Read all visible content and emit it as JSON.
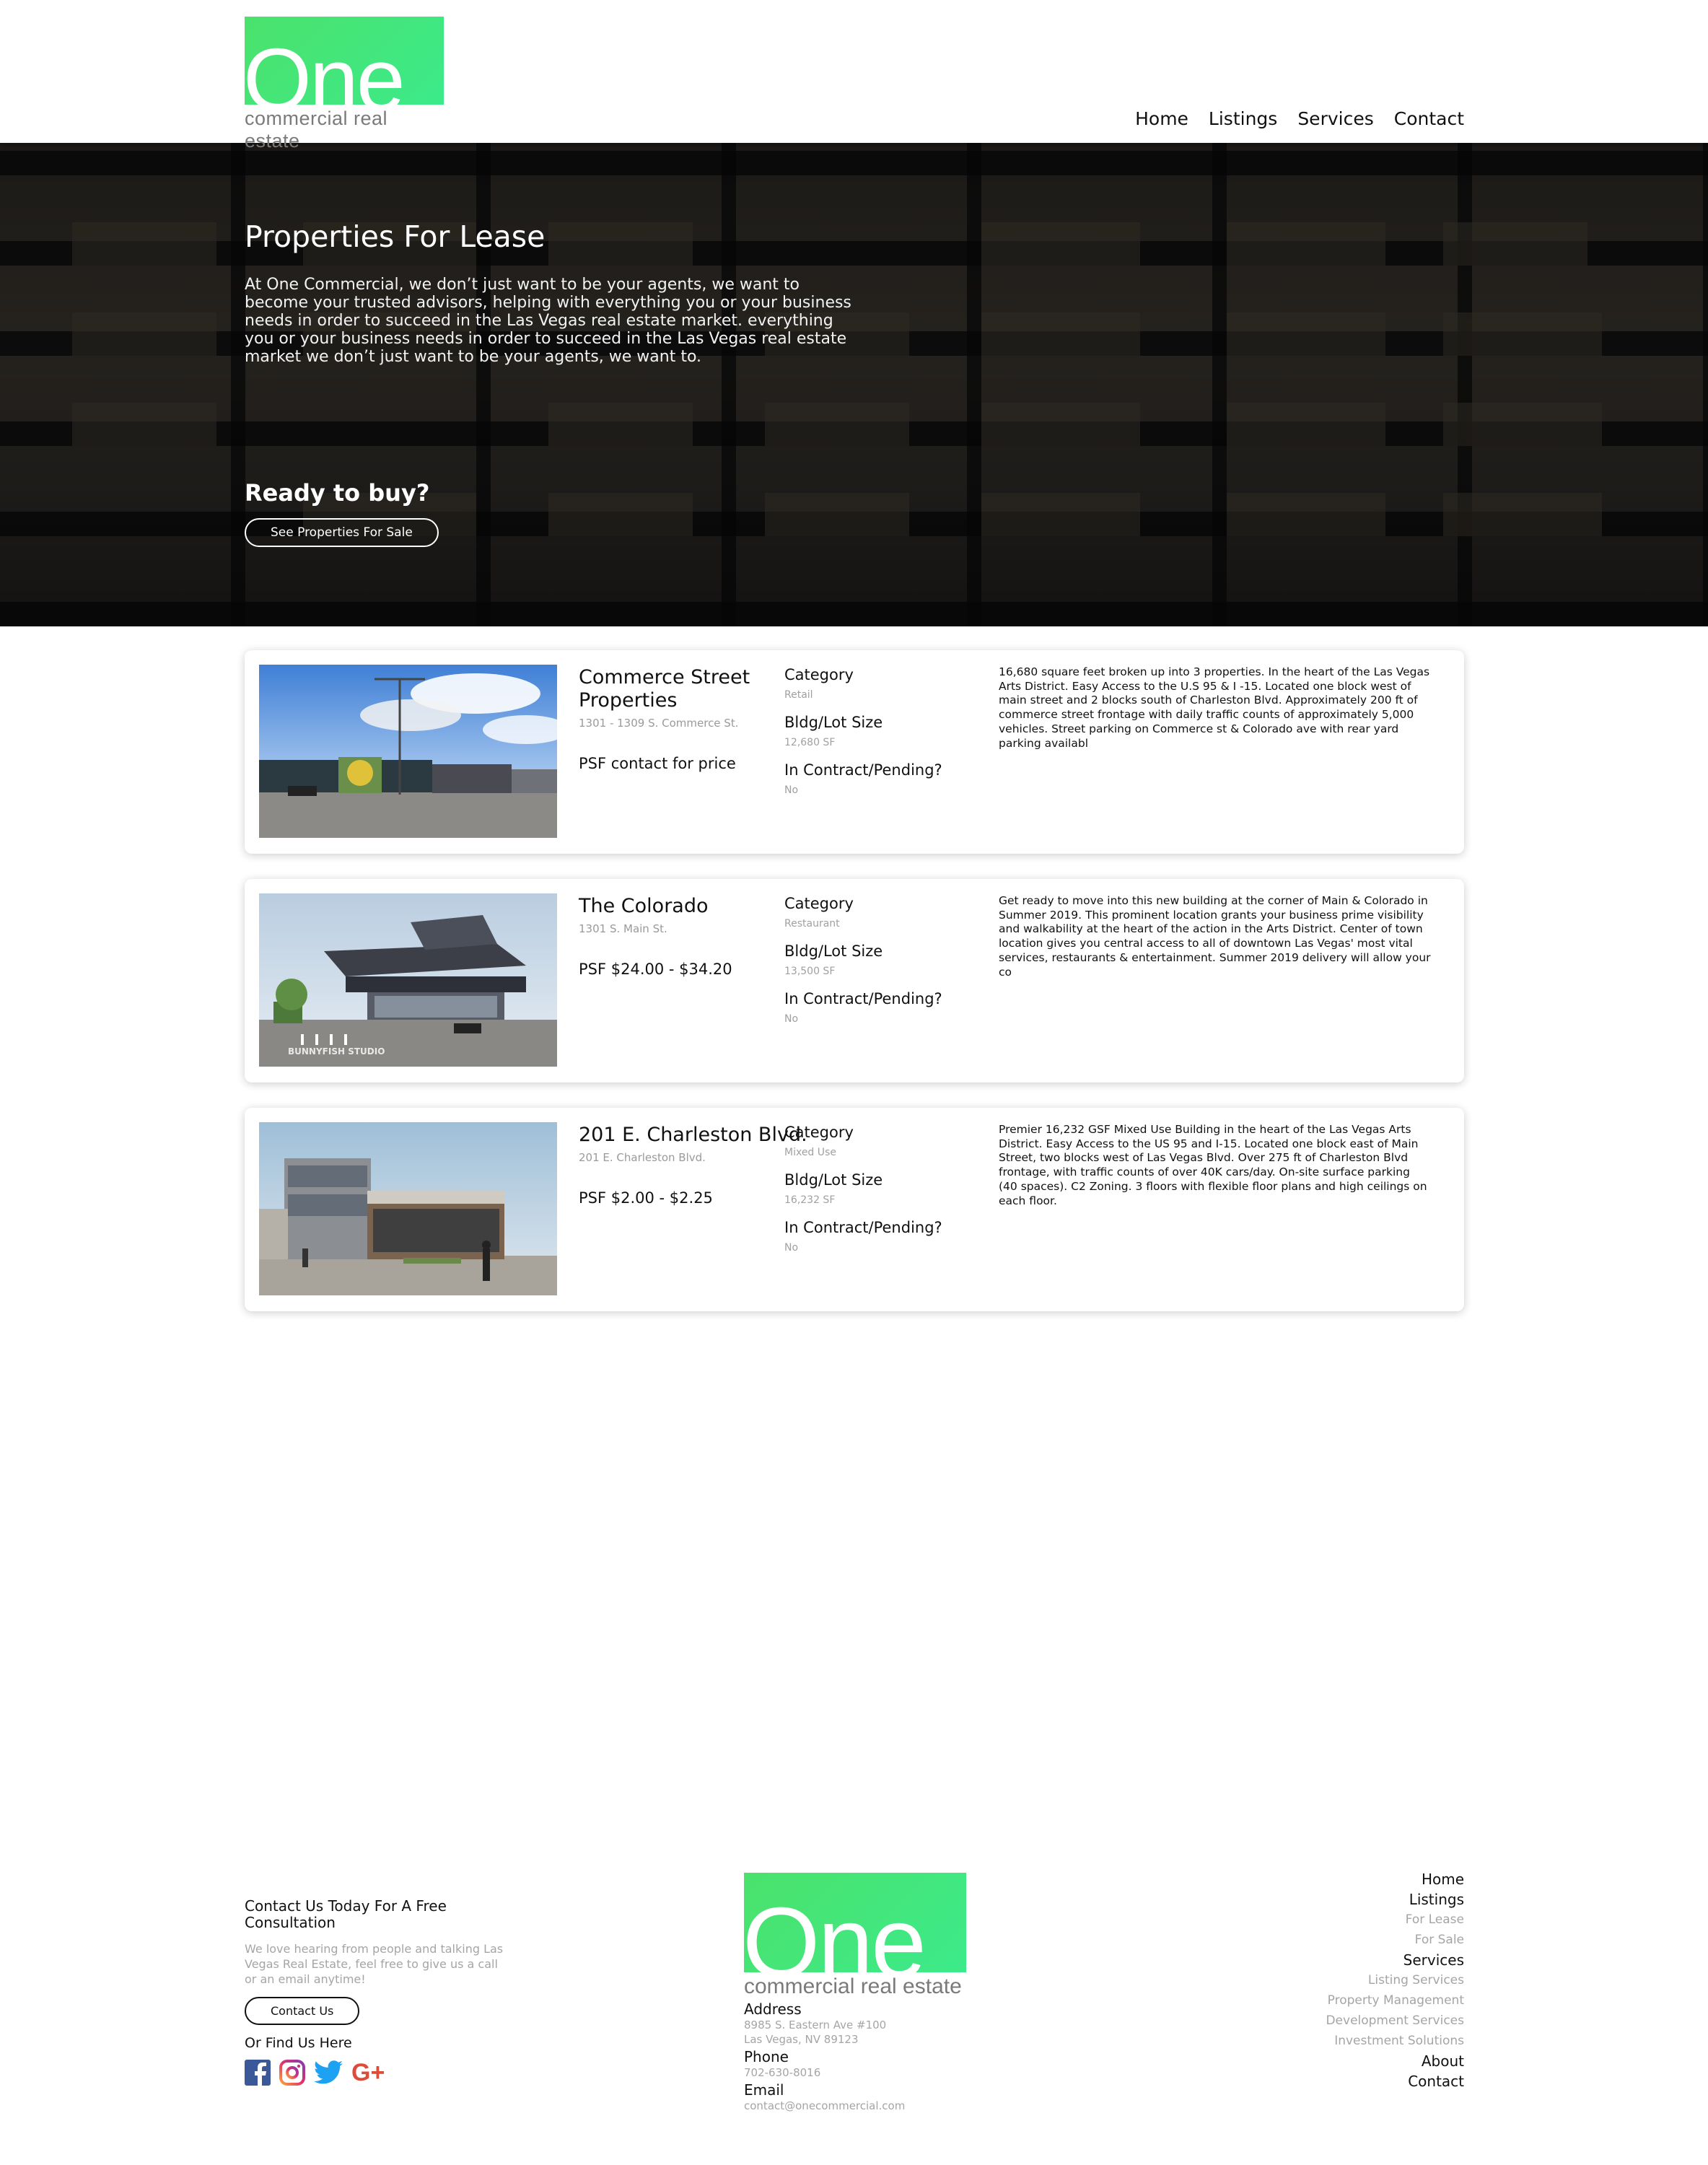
{
  "header": {
    "logo_word": "One",
    "logo_sub": "commercial real estate",
    "nav": [
      "Home",
      "Listings",
      "Services",
      "Contact"
    ]
  },
  "hero": {
    "title": "Properties For Lease",
    "text": "At One Commercial, we don’t just want to be your agents, we want to become your trusted advisors, helping with everything you or your business needs in order to succeed in the Las Vegas real estate market. everything you or your business needs in order to succeed in the Las Vegas real estate market we don’t just want to be your agents, we want to.",
    "ready": "Ready to buy?",
    "button": "See Properties For Sale"
  },
  "listings": [
    {
      "name": "Commerce Street Properties",
      "address": "1301 - 1309 S. Commerce St.",
      "price": "PSF contact for price",
      "category_label": "Category",
      "category": "Retail",
      "size_label": "Bldg/Lot Size",
      "size": "12,680 SF",
      "contract_label": "In Contract/Pending?",
      "contract": "No",
      "description": "16,680 square feet broken up into 3 properties. In the heart of the Las Vegas Arts District. Easy Access to the U.S 95 & I -15. Located one block west of main street and 2 blocks south of Charleston Blvd. Approximately 200 ft of commerce street frontage with daily traffic counts of approximately 5,000 vehicles. Street parking on Commerce st & Colorado ave with rear yard parking availabl"
    },
    {
      "name": "The Colorado",
      "address": "1301 S. Main St.",
      "price": "PSF $24.00 - $34.20",
      "category_label": "Category",
      "category": "Restaurant",
      "size_label": "Bldg/Lot Size",
      "size": "13,500 SF",
      "contract_label": "In Contract/Pending?",
      "contract": "No",
      "description": "Get ready to move into this new building at the corner of Main & Colorado in Summer 2019. This prominent location grants your business prime visibility and walkability at the heart of the action in the Arts District. Center of town location gives you central access to all of downtown Las Vegas' most vital services, restaurants & entertainment. Summer 2019 delivery will allow your co",
      "watermark": "BUNNYFISH STUDIO"
    },
    {
      "name": "201 E. Charleston Blvd.",
      "address": "201 E. Charleston Blvd.",
      "price": "PSF $2.00 - $2.25",
      "category_label": "Category",
      "category": "Mixed Use",
      "size_label": "Bldg/Lot Size",
      "size": "16,232 SF",
      "contract_label": "In Contract/Pending?",
      "contract": "No",
      "description": "Premier 16,232 GSF Mixed Use Building in the heart of the Las Vegas Arts District.  Easy Access to the US 95 and I-15.  Located one block east of Main Street, two blocks west of Las Vegas Blvd.  Over 275 ft of Charleston Blvd frontage, with traffic counts of over 40K cars/day.  On-site surface parking (40 spaces).  C2 Zoning.  3 floors with flexible floor plans and high ceilings on each floor."
    }
  ],
  "footer": {
    "contact_heading": "Contact Us Today For A Free Consultation",
    "contact_text": "We love hearing from people and talking Las Vegas Real Estate, feel free to give us a call or an email anytime!",
    "contact_button": "Contact Us",
    "find_us": "Or Find Us Here",
    "logo_word": "One",
    "logo_sub": "commercial real estate",
    "address_label": "Address",
    "address_line1": "8985 S. Eastern Ave #100",
    "address_line2": "Las Vegas, NV 89123",
    "phone_label": "Phone",
    "phone": "702-630-8016",
    "email_label": "Email",
    "email": "contact@onecommercial.com",
    "links": {
      "home": "Home",
      "listings": "Listings",
      "for_lease": "For Lease",
      "for_sale": "For Sale",
      "services": "Services",
      "listing_services": "Listing Services",
      "property_management": "Property Management",
      "development_services": "Development Services",
      "investment_solutions": "Investment Solutions",
      "about": "About",
      "contact": "Contact"
    },
    "social_icons": [
      "facebook-icon",
      "instagram-icon",
      "twitter-icon",
      "google-plus-icon"
    ]
  },
  "colors": {
    "brand_green": "#4be26c",
    "muted_text": "#a5a5a5"
  }
}
